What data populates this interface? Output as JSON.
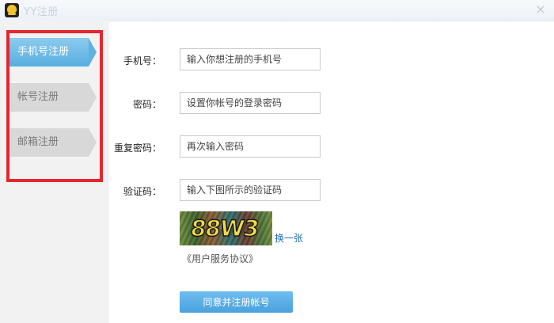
{
  "window": {
    "title": "YY注册",
    "close_label": "×"
  },
  "sidebar": {
    "tabs": [
      {
        "label": "手机号注册",
        "active": true
      },
      {
        "label": "帐号注册",
        "active": false
      },
      {
        "label": "邮箱注册",
        "active": false
      }
    ]
  },
  "form": {
    "phone": {
      "label": "手机号：",
      "placeholder": "输入你想注册的手机号",
      "value": ""
    },
    "password": {
      "label": "密码：",
      "placeholder": "设置你帐号的登录密码",
      "value": ""
    },
    "confirm_password": {
      "label": "重复密码：",
      "placeholder": "再次输入密码",
      "value": ""
    },
    "captcha": {
      "label": "验证码：",
      "placeholder": "输入下图所示的验证码",
      "value": "",
      "image_text": "88W3"
    },
    "refresh_label": "换一张",
    "agreement_label": "《用户服务协议》",
    "submit_label": "同意并注册帐号"
  },
  "colors": {
    "active_tab": "#57aee0",
    "inactive_tab": "#d8d8d8",
    "highlight": "#e3262f",
    "button": "#4aa1dc",
    "link": "#1e6fb8"
  }
}
